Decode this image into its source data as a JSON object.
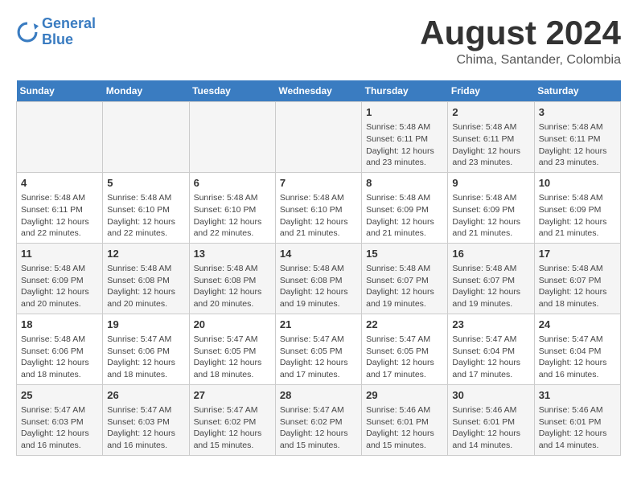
{
  "logo": {
    "line1": "General",
    "line2": "Blue"
  },
  "title": "August 2024",
  "subtitle": "Chima, Santander, Colombia",
  "days_of_week": [
    "Sunday",
    "Monday",
    "Tuesday",
    "Wednesday",
    "Thursday",
    "Friday",
    "Saturday"
  ],
  "weeks": [
    [
      {
        "day": "",
        "info": ""
      },
      {
        "day": "",
        "info": ""
      },
      {
        "day": "",
        "info": ""
      },
      {
        "day": "",
        "info": ""
      },
      {
        "day": "1",
        "info": "Sunrise: 5:48 AM\nSunset: 6:11 PM\nDaylight: 12 hours\nand 23 minutes."
      },
      {
        "day": "2",
        "info": "Sunrise: 5:48 AM\nSunset: 6:11 PM\nDaylight: 12 hours\nand 23 minutes."
      },
      {
        "day": "3",
        "info": "Sunrise: 5:48 AM\nSunset: 6:11 PM\nDaylight: 12 hours\nand 23 minutes."
      }
    ],
    [
      {
        "day": "4",
        "info": "Sunrise: 5:48 AM\nSunset: 6:11 PM\nDaylight: 12 hours\nand 22 minutes."
      },
      {
        "day": "5",
        "info": "Sunrise: 5:48 AM\nSunset: 6:10 PM\nDaylight: 12 hours\nand 22 minutes."
      },
      {
        "day": "6",
        "info": "Sunrise: 5:48 AM\nSunset: 6:10 PM\nDaylight: 12 hours\nand 22 minutes."
      },
      {
        "day": "7",
        "info": "Sunrise: 5:48 AM\nSunset: 6:10 PM\nDaylight: 12 hours\nand 21 minutes."
      },
      {
        "day": "8",
        "info": "Sunrise: 5:48 AM\nSunset: 6:09 PM\nDaylight: 12 hours\nand 21 minutes."
      },
      {
        "day": "9",
        "info": "Sunrise: 5:48 AM\nSunset: 6:09 PM\nDaylight: 12 hours\nand 21 minutes."
      },
      {
        "day": "10",
        "info": "Sunrise: 5:48 AM\nSunset: 6:09 PM\nDaylight: 12 hours\nand 21 minutes."
      }
    ],
    [
      {
        "day": "11",
        "info": "Sunrise: 5:48 AM\nSunset: 6:09 PM\nDaylight: 12 hours\nand 20 minutes."
      },
      {
        "day": "12",
        "info": "Sunrise: 5:48 AM\nSunset: 6:08 PM\nDaylight: 12 hours\nand 20 minutes."
      },
      {
        "day": "13",
        "info": "Sunrise: 5:48 AM\nSunset: 6:08 PM\nDaylight: 12 hours\nand 20 minutes."
      },
      {
        "day": "14",
        "info": "Sunrise: 5:48 AM\nSunset: 6:08 PM\nDaylight: 12 hours\nand 19 minutes."
      },
      {
        "day": "15",
        "info": "Sunrise: 5:48 AM\nSunset: 6:07 PM\nDaylight: 12 hours\nand 19 minutes."
      },
      {
        "day": "16",
        "info": "Sunrise: 5:48 AM\nSunset: 6:07 PM\nDaylight: 12 hours\nand 19 minutes."
      },
      {
        "day": "17",
        "info": "Sunrise: 5:48 AM\nSunset: 6:07 PM\nDaylight: 12 hours\nand 18 minutes."
      }
    ],
    [
      {
        "day": "18",
        "info": "Sunrise: 5:48 AM\nSunset: 6:06 PM\nDaylight: 12 hours\nand 18 minutes."
      },
      {
        "day": "19",
        "info": "Sunrise: 5:47 AM\nSunset: 6:06 PM\nDaylight: 12 hours\nand 18 minutes."
      },
      {
        "day": "20",
        "info": "Sunrise: 5:47 AM\nSunset: 6:05 PM\nDaylight: 12 hours\nand 18 minutes."
      },
      {
        "day": "21",
        "info": "Sunrise: 5:47 AM\nSunset: 6:05 PM\nDaylight: 12 hours\nand 17 minutes."
      },
      {
        "day": "22",
        "info": "Sunrise: 5:47 AM\nSunset: 6:05 PM\nDaylight: 12 hours\nand 17 minutes."
      },
      {
        "day": "23",
        "info": "Sunrise: 5:47 AM\nSunset: 6:04 PM\nDaylight: 12 hours\nand 17 minutes."
      },
      {
        "day": "24",
        "info": "Sunrise: 5:47 AM\nSunset: 6:04 PM\nDaylight: 12 hours\nand 16 minutes."
      }
    ],
    [
      {
        "day": "25",
        "info": "Sunrise: 5:47 AM\nSunset: 6:03 PM\nDaylight: 12 hours\nand 16 minutes."
      },
      {
        "day": "26",
        "info": "Sunrise: 5:47 AM\nSunset: 6:03 PM\nDaylight: 12 hours\nand 16 minutes."
      },
      {
        "day": "27",
        "info": "Sunrise: 5:47 AM\nSunset: 6:02 PM\nDaylight: 12 hours\nand 15 minutes."
      },
      {
        "day": "28",
        "info": "Sunrise: 5:47 AM\nSunset: 6:02 PM\nDaylight: 12 hours\nand 15 minutes."
      },
      {
        "day": "29",
        "info": "Sunrise: 5:46 AM\nSunset: 6:01 PM\nDaylight: 12 hours\nand 15 minutes."
      },
      {
        "day": "30",
        "info": "Sunrise: 5:46 AM\nSunset: 6:01 PM\nDaylight: 12 hours\nand 14 minutes."
      },
      {
        "day": "31",
        "info": "Sunrise: 5:46 AM\nSunset: 6:01 PM\nDaylight: 12 hours\nand 14 minutes."
      }
    ]
  ]
}
